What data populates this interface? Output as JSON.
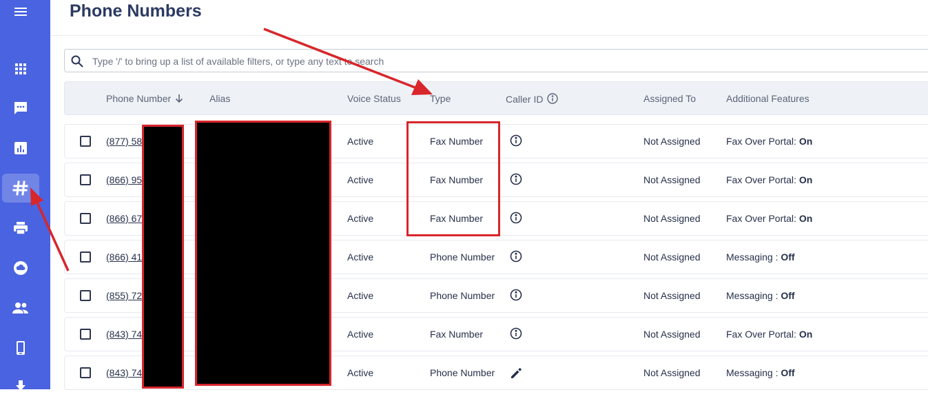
{
  "page": {
    "title": "Phone Numbers"
  },
  "sidebar": {
    "items": [
      {
        "icon": "menu-icon",
        "active": false
      },
      {
        "icon": "apps-grid-icon",
        "active": false
      },
      {
        "icon": "chat-icon",
        "active": false
      },
      {
        "icon": "bar-chart-icon",
        "active": false
      },
      {
        "icon": "hash-icon",
        "active": true
      },
      {
        "icon": "printer-icon",
        "active": false
      },
      {
        "icon": "cloud-icon",
        "active": false
      },
      {
        "icon": "users-icon",
        "active": false
      },
      {
        "icon": "mobile-icon",
        "active": false
      },
      {
        "icon": "download-icon",
        "active": false
      }
    ]
  },
  "search": {
    "placeholder": "Type '/' to bring up a list of available filters, or type any text to search",
    "value": ""
  },
  "table": {
    "columns": {
      "phone_number": "Phone Number",
      "alias": "Alias",
      "voice_status": "Voice Status",
      "type": "Type",
      "caller_id": "Caller ID",
      "assigned_to": "Assigned To",
      "additional_features": "Additional Features"
    },
    "rows": [
      {
        "phone": "(877) 58",
        "voice_status": "Active",
        "type": "Fax Number",
        "caller_id_icon": "info-icon",
        "assigned_to": "Not Assigned",
        "feature_label": "Fax Over Portal:",
        "feature_value": "On"
      },
      {
        "phone": "(866) 95",
        "voice_status": "Active",
        "type": "Fax Number",
        "caller_id_icon": "info-icon",
        "assigned_to": "Not Assigned",
        "feature_label": "Fax Over Portal:",
        "feature_value": "On"
      },
      {
        "phone": "(866) 67",
        "voice_status": "Active",
        "type": "Fax Number",
        "caller_id_icon": "info-icon",
        "assigned_to": "Not Assigned",
        "feature_label": "Fax Over Portal:",
        "feature_value": "On"
      },
      {
        "phone": "(866) 41",
        "voice_status": "Active",
        "type": "Phone Number",
        "caller_id_icon": "info-icon",
        "assigned_to": "Not Assigned",
        "feature_label": "Messaging :",
        "feature_value": "Off"
      },
      {
        "phone": "(855) 72",
        "voice_status": "Active",
        "type": "Phone Number",
        "caller_id_icon": "info-icon",
        "assigned_to": "Not Assigned",
        "feature_label": "Messaging :",
        "feature_value": "Off"
      },
      {
        "phone": "(843) 74",
        "voice_status": "Active",
        "type": "Fax Number",
        "caller_id_icon": "info-icon",
        "assigned_to": "Not Assigned",
        "feature_label": "Fax Over Portal:",
        "feature_value": "On"
      },
      {
        "phone": "(843) 74",
        "voice_status": "Active",
        "type": "Phone Number",
        "caller_id_icon": "pencil-icon",
        "assigned_to": "Not Assigned",
        "feature_label": "Messaging :",
        "feature_value": "Off"
      }
    ]
  },
  "colors": {
    "sidebar": "#4a63e0",
    "annotation_red": "#d8262b",
    "title": "#2c3a63"
  }
}
